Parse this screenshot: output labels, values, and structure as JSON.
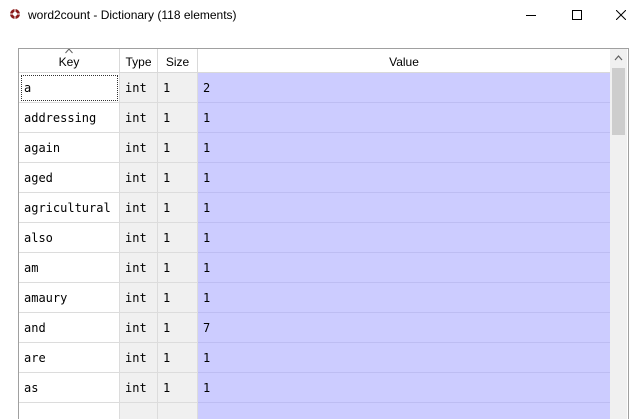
{
  "window": {
    "title": "word2count - Dictionary (118 elements)",
    "icons": {
      "app": "spyder-icon",
      "minimize": "minimize-icon",
      "maximize": "maximize-icon",
      "close": "close-icon"
    }
  },
  "table": {
    "columns": [
      "Key",
      "Type",
      "Size",
      "Value"
    ],
    "sorted_column": "Key",
    "value_color": "#ccccff",
    "rows": [
      {
        "key": "a",
        "type": "int",
        "size": "1",
        "value": "2"
      },
      {
        "key": "addressing",
        "type": "int",
        "size": "1",
        "value": "1"
      },
      {
        "key": "again",
        "type": "int",
        "size": "1",
        "value": "1"
      },
      {
        "key": "aged",
        "type": "int",
        "size": "1",
        "value": "1"
      },
      {
        "key": "agricultural",
        "type": "int",
        "size": "1",
        "value": "1"
      },
      {
        "key": "also",
        "type": "int",
        "size": "1",
        "value": "1"
      },
      {
        "key": "am",
        "type": "int",
        "size": "1",
        "value": "1"
      },
      {
        "key": "amaury",
        "type": "int",
        "size": "1",
        "value": "1"
      },
      {
        "key": "and",
        "type": "int",
        "size": "1",
        "value": "7"
      },
      {
        "key": "are",
        "type": "int",
        "size": "1",
        "value": "1"
      },
      {
        "key": "as",
        "type": "int",
        "size": "1",
        "value": "1"
      },
      {
        "key": "",
        "type": "",
        "size": "",
        "value": ""
      }
    ]
  }
}
